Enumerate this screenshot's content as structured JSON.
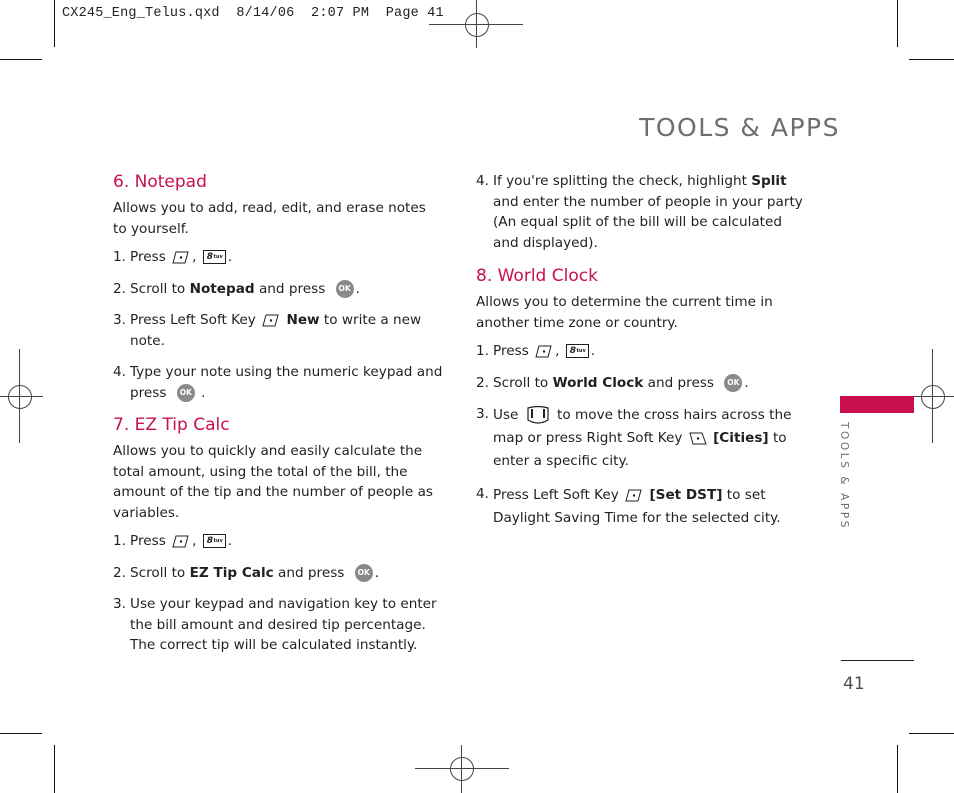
{
  "slug": "CX245_Eng_Telus.qxd  8/14/06  2:07 PM  Page 41",
  "page_title": "TOOLS & APPS",
  "side_label": "TOOLS & APPS",
  "page_number": "41",
  "colors": {
    "accent": "#c8104e",
    "title_gray": "#6d6e71",
    "body": "#231f20"
  },
  "icons": {
    "left_soft_key": "left-soft-key-icon",
    "right_soft_key": "right-soft-key-icon",
    "key_8": {
      "main": "8",
      "sub": "tuv"
    },
    "ok_key": "OK",
    "nav_key": "navigation-key-icon"
  },
  "notepad": {
    "heading": "6. Notepad",
    "intro": "Allows you to add, read, edit, and erase notes to yourself.",
    "steps": [
      {
        "num": "1.",
        "pre": "Press",
        "sep": ",",
        "post": "."
      },
      {
        "num": "2.",
        "pre": "Scroll to ",
        "bold": "Notepad",
        "post": " and press",
        "end": "."
      },
      {
        "num": "3.",
        "pre": "Press Left Soft Key",
        "bold": "New",
        "post": " to write a new note."
      },
      {
        "num": "4.",
        "pre": "Type your note using the numeric keypad and press",
        "end": "."
      }
    ]
  },
  "tipcalc": {
    "heading": "7. EZ Tip Calc",
    "intro": "Allows you to quickly and easily calculate the total amount, using the total of the bill, the amount of the tip and the number of people as variables.",
    "steps": [
      {
        "num": "1.",
        "pre": "Press",
        "sep": ",",
        "post": "."
      },
      {
        "num": "2.",
        "pre": "Scroll to ",
        "bold": "EZ Tip Calc",
        "post": " and press",
        "end": "."
      },
      {
        "num": "3.",
        "text": "Use your keypad and navigation key to enter the bill amount and desired tip percentage. The correct tip will be calculated instantly."
      },
      {
        "num": "4.",
        "pre": "If you're splitting the check, highlight ",
        "bold": "Split",
        "post": " and enter the number of people in your party (An equal split of the bill will be calculated and displayed)."
      }
    ]
  },
  "worldclock": {
    "heading": "8. World Clock",
    "intro": "Allows you to determine the current time in another time zone or country.",
    "steps": [
      {
        "num": "1.",
        "pre": "Press",
        "sep": ",",
        "post": "."
      },
      {
        "num": "2.",
        "pre": "Scroll to ",
        "bold": "World Clock",
        "post": " and press",
        "end": "."
      },
      {
        "num": "3.",
        "pre": "Use",
        "mid": " to move the cross hairs across the map or press Right Soft Key",
        "bold": "[Cities]",
        "post": " to enter a specific city."
      },
      {
        "num": "4.",
        "pre": "Press Left Soft Key",
        "bold": "[Set DST]",
        "post": " to set Daylight Saving Time for the selected city."
      }
    ]
  }
}
